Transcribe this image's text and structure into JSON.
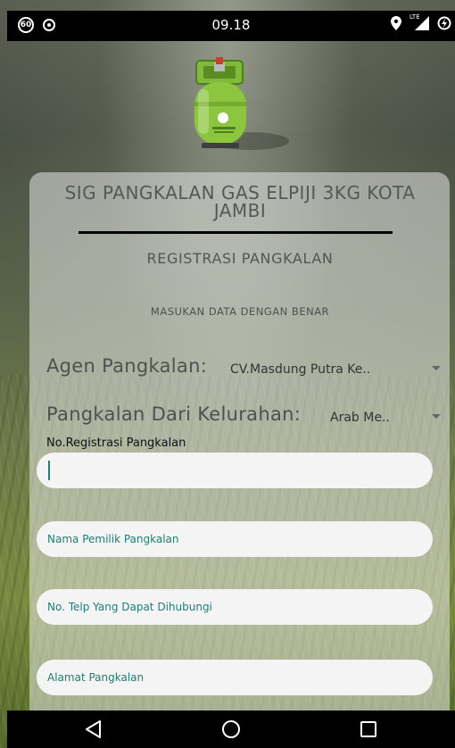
{
  "status_bar": {
    "notification_badge": "60",
    "time": "09.18",
    "network_label": "LTE"
  },
  "app": {
    "title": "SIG PANGKALAN GAS ELPIJI 3KG KOTA JAMBI",
    "subtitle": "REGISTRASI PANGKALAN",
    "hint": "MASUKAN DATA DENGAN BENAR"
  },
  "form": {
    "agen": {
      "label": "Agen Pangkalan:",
      "value": "CV.Masdung Putra Ke.."
    },
    "kelurahan": {
      "label": "Pangkalan Dari Kelurahan:",
      "value": "Arab Me.."
    },
    "no_registrasi": {
      "label": "No.Registrasi Pangkalan",
      "value": ""
    },
    "nama_pemilik": {
      "placeholder": "Nama Pemilik Pangkalan"
    },
    "no_telp": {
      "placeholder": "No. Telp Yang Dapat Dihubungi"
    },
    "alamat": {
      "placeholder": "Alamat Pangkalan"
    }
  },
  "colors": {
    "accent": "#1e7f74",
    "card": "#ececec",
    "navbar": "#000000",
    "gas_tank": "#8cc63f"
  },
  "icons": {
    "logo": "gas-cylinder-icon",
    "nav_back": "back-triangle-icon",
    "nav_home": "home-circle-icon",
    "nav_recents": "recents-square-icon"
  }
}
